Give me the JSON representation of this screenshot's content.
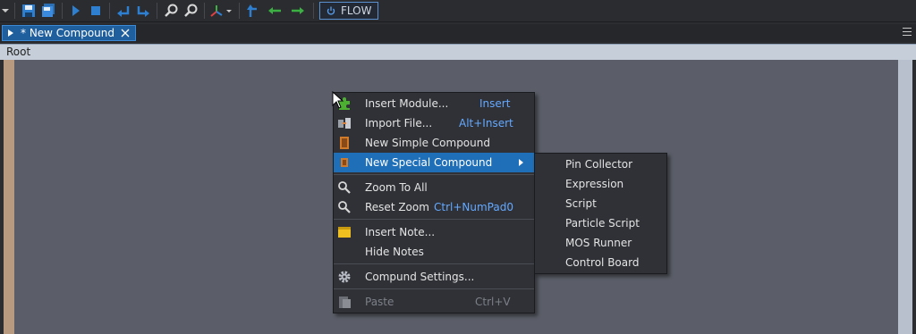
{
  "toolbar": {
    "icons": [
      "dropdown-arrow-icon",
      "save-icon",
      "save-all-icon",
      "run-icon",
      "stop-icon",
      "undo-icon",
      "redo-icon",
      "zoom-in-icon",
      "zoom-out-icon",
      "axis-icon",
      "go-up-icon",
      "back-icon",
      "forward-icon"
    ],
    "flow_label": "FLOW"
  },
  "tabs": [
    {
      "label": "* New Compound",
      "active": true
    }
  ],
  "breadcrumb": "Root",
  "context_menu": {
    "items": [
      {
        "label": "Insert Module...",
        "shortcut": "Insert",
        "icon": "puzzle-icon"
      },
      {
        "label": "Import File...",
        "shortcut": "Alt+Insert",
        "icon": "import-file-icon"
      },
      {
        "label": "New Simple Compound",
        "shortcut": "",
        "icon": "compound-icon"
      },
      {
        "label": "New Special Compound",
        "shortcut": "",
        "icon": "special-compound-icon",
        "submenu": true,
        "highlighted": true
      },
      {
        "label": "Zoom To All",
        "shortcut": "",
        "icon": "zoom-icon"
      },
      {
        "label": "Reset Zoom",
        "shortcut": "Ctrl+NumPad0",
        "icon": "zoom-reset-icon"
      },
      {
        "label": "Insert Note...",
        "shortcut": "",
        "icon": "note-icon"
      },
      {
        "label": "Hide Notes",
        "shortcut": "",
        "icon": ""
      },
      {
        "label": "Compund Settings...",
        "shortcut": "",
        "icon": "gear-icon"
      },
      {
        "label": "Paste",
        "shortcut": "Ctrl+V",
        "icon": "paste-icon",
        "disabled": true
      }
    ]
  },
  "submenu": {
    "items": [
      "Pin Collector",
      "Expression",
      "Script",
      "Particle Script",
      "MOS Runner",
      "Control Board"
    ]
  },
  "colors": {
    "accent": "#1f6fb8",
    "shortcut": "#64a9ff",
    "canvas": "#5b5e68",
    "menu_bg": "#2f3136"
  }
}
